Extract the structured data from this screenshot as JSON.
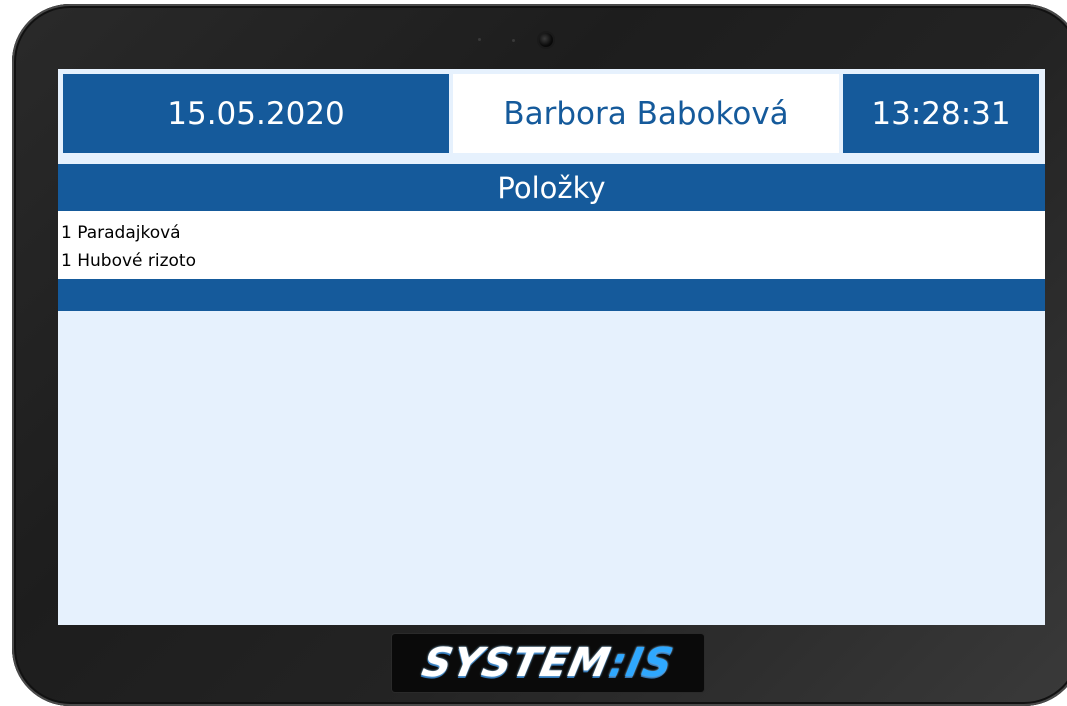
{
  "header": {
    "date": "15.05.2020",
    "user_name": "Barbora Baboková",
    "time": "13:28:31"
  },
  "section": {
    "title": "Položky"
  },
  "items": [
    {
      "text": "1 Paradajková"
    },
    {
      "text": "1 Hubové rizoto"
    }
  ],
  "brand": {
    "logo_main": "SYSTEM",
    "logo_accent": "IS"
  },
  "colors": {
    "primary": "#155a9b",
    "screen_background": "#e6f1fd",
    "accent": "#2fa8ff"
  }
}
